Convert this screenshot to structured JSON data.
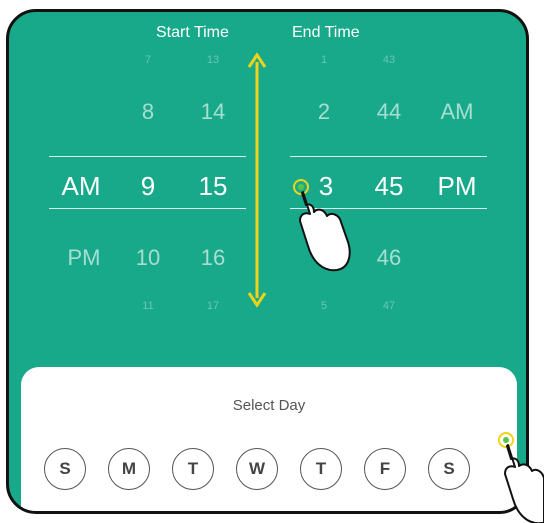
{
  "header": {
    "start_label": "Start Time",
    "end_label": "End Time"
  },
  "start_picker": {
    "period": {
      "near_below": "PM",
      "selected": "AM"
    },
    "hour": {
      "far_above": "7",
      "near_above": "8",
      "selected": "9",
      "near_below": "10",
      "far_below": "11"
    },
    "minute": {
      "far_above": "13",
      "near_above": "14",
      "selected": "15",
      "near_below": "16",
      "far_below": "17"
    }
  },
  "end_picker": {
    "hour": {
      "far_above": "1",
      "near_above": "2",
      "selected": "3",
      "far_below": "5"
    },
    "minute": {
      "far_above": "43",
      "near_above": "44",
      "selected": "45",
      "near_below": "46",
      "far_below": "47"
    },
    "period": {
      "near_above": "AM",
      "selected": "PM"
    }
  },
  "day_sheet": {
    "title": "Select Day",
    "days": [
      "S",
      "M",
      "T",
      "W",
      "T",
      "F",
      "S"
    ]
  },
  "colors": {
    "background": "#17a98a",
    "annotation_arrow": "#f2d31a"
  },
  "icons": {
    "hand": "pointing-hand-icon",
    "arrow": "double-arrow-icon"
  }
}
